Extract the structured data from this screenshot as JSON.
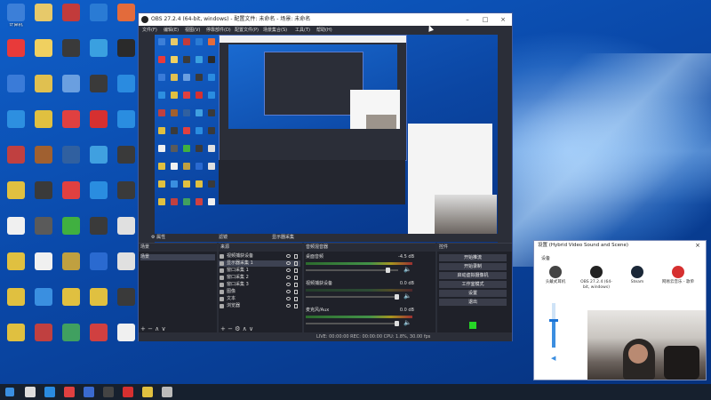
{
  "desktop": {
    "icons": [
      {
        "label": "计算机",
        "color": "#3c7fd8"
      },
      {
        "label": "",
        "color": "#e7c96a"
      },
      {
        "label": "",
        "color": "#c23b3b"
      },
      {
        "label": "",
        "color": "#2a7bd4"
      },
      {
        "label": "",
        "color": "#e36b3b"
      },
      {
        "label": "",
        "color": "#e83a3a"
      },
      {
        "label": "",
        "color": "#f0d060"
      },
      {
        "label": "",
        "color": "#3a3a3a"
      },
      {
        "label": "",
        "color": "#3aa0e0"
      },
      {
        "label": "",
        "color": "#2a2a2a"
      },
      {
        "label": "",
        "color": "#3a7bd8"
      },
      {
        "label": "",
        "color": "#e0c050"
      },
      {
        "label": "",
        "color": "#6a9fe0"
      },
      {
        "label": "",
        "color": "#3a3a3a"
      },
      {
        "label": "",
        "color": "#2a8be0"
      },
      {
        "label": "",
        "color": "#2d8fe0"
      },
      {
        "label": "",
        "color": "#e0c040"
      },
      {
        "label": "",
        "color": "#e04040"
      },
      {
        "label": "",
        "color": "#d63030"
      },
      {
        "label": "",
        "color": "#2a8de0"
      },
      {
        "label": "",
        "color": "#c04040"
      },
      {
        "label": "",
        "color": "#a06030"
      },
      {
        "label": "",
        "color": "#3060a0"
      },
      {
        "label": "",
        "color": "#40a0e0"
      },
      {
        "label": "",
        "color": "#3a3a3a"
      },
      {
        "label": "",
        "color": "#e0c040"
      },
      {
        "label": "",
        "color": "#3a3a3a"
      },
      {
        "label": "",
        "color": "#e04040"
      },
      {
        "label": "",
        "color": "#2a8de0"
      },
      {
        "label": "",
        "color": "#3a3a3a"
      },
      {
        "label": "",
        "color": "#f0f0f0"
      },
      {
        "label": "",
        "color": "#5a5a5a"
      },
      {
        "label": "",
        "color": "#40b040"
      },
      {
        "label": "",
        "color": "#3a3a3a"
      },
      {
        "label": "",
        "color": "#e0e0e0"
      },
      {
        "label": "",
        "color": "#e0c040"
      },
      {
        "label": "",
        "color": "#f0f0f0"
      },
      {
        "label": "",
        "color": "#c0a040"
      },
      {
        "label": "",
        "color": "#2a6ad0"
      },
      {
        "label": "",
        "color": "#e0e0e0"
      },
      {
        "label": "",
        "color": "#e0c040"
      },
      {
        "label": "",
        "color": "#3a8fe0"
      },
      {
        "label": "",
        "color": "#e0c040"
      },
      {
        "label": "",
        "color": "#e0c040"
      },
      {
        "label": "",
        "color": "#3a3a3a"
      },
      {
        "label": "",
        "color": "#e0c040"
      },
      {
        "label": "",
        "color": "#c04040"
      },
      {
        "label": "",
        "color": "#40a060"
      },
      {
        "label": "",
        "color": "#d04040"
      },
      {
        "label": "",
        "color": "#f0f0f0"
      }
    ]
  },
  "obs": {
    "title": "OBS 27.2.4 (64-bit, windows) - 配置文件: 未命名 - 场景: 未命名",
    "menu": [
      "文件(F)",
      "编辑(E)",
      "视图(V)",
      "停靠部件(D)",
      "配置文件(P)",
      "场景集合(S)",
      "工具(T)",
      "帮助(H)"
    ],
    "toolbar_label": "显示器采集",
    "scenes_header": "场景",
    "scenes": [
      "场景"
    ],
    "sources_header": "来源",
    "sources": [
      "视频捕获设备",
      "显示器采集 1",
      "窗口采集 1",
      "窗口采集 2",
      "窗口采集 3",
      "图像",
      "文本",
      "浏览器"
    ],
    "mixer_header": "音频混音器",
    "mixer": [
      {
        "name": "桌面音频",
        "db": "-4.5 dB"
      },
      {
        "name": "视频捕获设备",
        "db": "0.0 dB"
      },
      {
        "name": "麦克风/Aux",
        "db": "0.0 dB"
      }
    ],
    "transitions_header": "场景转场",
    "controls_header": "控件",
    "controls": [
      "开始推流",
      "开始录制",
      "启动虚拟摄像机",
      "工作室模式",
      "设置",
      "退出"
    ],
    "status": "LIVE: 00:00:00  REC: 00:00:00  CPU: 1.8%, 30.00 fps"
  },
  "props": {
    "title": "设置 (Hybrid Video Sound and Scene)",
    "section_label": "设备",
    "devices": [
      {
        "label": "头戴式耳机",
        "color": "#444444"
      },
      {
        "label": "OBS 27.2.4 (64-bit, windows)",
        "color": "#222222"
      },
      {
        "label": "Steam",
        "color": "#1b2838"
      },
      {
        "label": "网易云音乐 - 歌单",
        "color": "#d63030"
      }
    ]
  },
  "taskbar": {
    "items": [
      {
        "name": "start-icon",
        "color": "#3a8fe0"
      },
      {
        "name": "search-icon",
        "color": "#dddddd"
      },
      {
        "name": "edge-icon",
        "color": "#2a8be0"
      },
      {
        "name": "chrome-icon",
        "color": "#e04040"
      },
      {
        "name": "steam-icon",
        "color": "#3a6ad0"
      },
      {
        "name": "obs-icon",
        "color": "#444444"
      },
      {
        "name": "netease-icon",
        "color": "#d63030"
      },
      {
        "name": "app-icon-yellow",
        "color": "#e0c040"
      },
      {
        "name": "app-icon-gray",
        "color": "#bbbbbb"
      }
    ]
  }
}
